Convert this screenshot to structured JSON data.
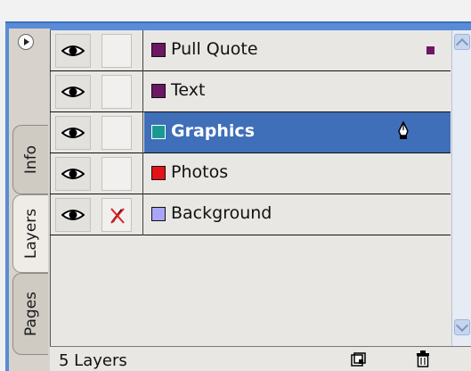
{
  "panel": {
    "tabs": [
      {
        "label": "Info"
      },
      {
        "label": "Layers"
      },
      {
        "label": "Pages"
      }
    ],
    "active_tab": "Layers"
  },
  "layers": [
    {
      "name": "Pull Quote",
      "color": "#6b1764",
      "visible": true,
      "locked": false,
      "selected": false,
      "has_selection_marker": true
    },
    {
      "name": "Text",
      "color": "#6b1764",
      "visible": true,
      "locked": false,
      "selected": false,
      "has_selection_marker": false
    },
    {
      "name": "Graphics",
      "color": "#1a9a8f",
      "visible": true,
      "locked": false,
      "selected": true,
      "has_selection_marker": false,
      "icon": "pen-icon"
    },
    {
      "name": "Photos",
      "color": "#e5121a",
      "visible": true,
      "locked": false,
      "selected": false,
      "has_selection_marker": false
    },
    {
      "name": "Background",
      "color": "#a9a6f7",
      "visible": true,
      "locked": true,
      "selected": false,
      "has_selection_marker": false
    }
  ],
  "status": {
    "text": "5 Layers"
  },
  "colors": {
    "selection": "#3f6fb9",
    "panel_accent": "#5a8bd6"
  }
}
